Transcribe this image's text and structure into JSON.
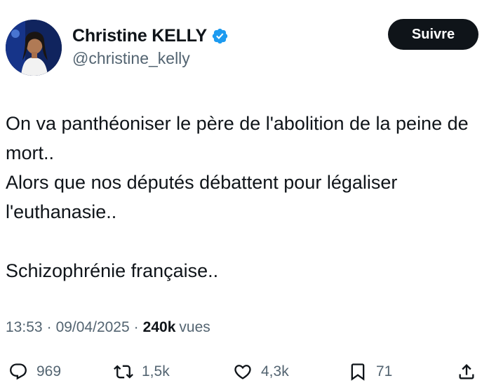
{
  "author": {
    "display_name": "Christine KELLY",
    "handle": "@christine_kelly",
    "verified": true,
    "verified_color": "#1d9bf0"
  },
  "follow_button": {
    "label": "Suivre"
  },
  "tweet": {
    "lines": [
      "On va panthéoniser le père de l'abolition de la peine de mort..",
      "Alors que nos députés débattent pour légaliser l'euthanasie..",
      "Schizophrénie française.."
    ]
  },
  "meta": {
    "time": "13:53",
    "date": "09/04/2025",
    "separator": "·",
    "views_count": "240k",
    "views_label": "vues"
  },
  "actions": {
    "reply": {
      "icon": "reply-icon",
      "count": "969"
    },
    "retweet": {
      "icon": "retweet-icon",
      "count": "1,5k"
    },
    "like": {
      "icon": "heart-icon",
      "count": "4,3k"
    },
    "bookmark": {
      "icon": "bookmark-icon",
      "count": "71"
    },
    "share": {
      "icon": "share-icon"
    }
  },
  "colors": {
    "text": "#0f1419",
    "secondary": "#536471",
    "button_bg": "#0f1419"
  }
}
